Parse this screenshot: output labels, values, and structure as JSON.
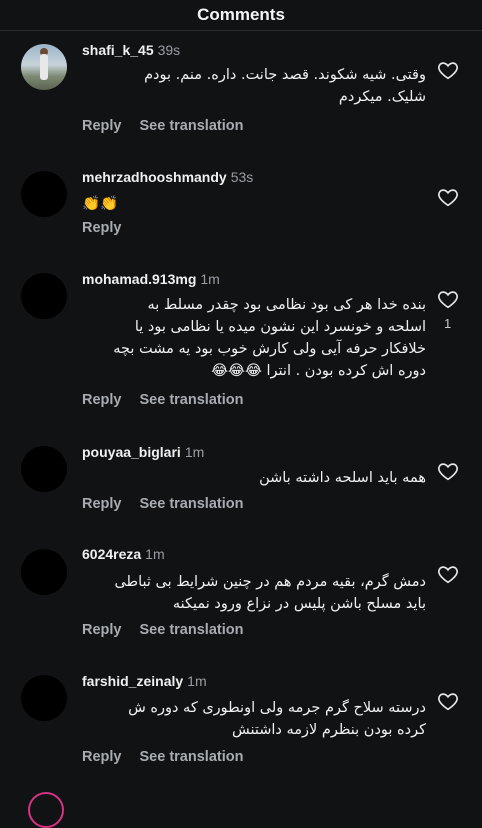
{
  "header": {
    "title": "Comments"
  },
  "labels": {
    "reply": "Reply",
    "see_translation": "See translation"
  },
  "comments": [
    {
      "username": "shafi_k_45",
      "time": "39s",
      "line1": "وقتی.  شیه شکوند. قصد جانت. داره. منم.  بودم",
      "line2": "شلیک. میکردم",
      "likes": ""
    },
    {
      "username": "mehrzadhooshmandy",
      "time": "53s",
      "text": "👏👏",
      "likes": ""
    },
    {
      "username": "mohamad.913mg",
      "time": "1m",
      "line1": "بنده خدا هر کی بود نظامی بود چقدر مسلط به",
      "line2": "اسلحه و خونسرد این نشون میده یا نظامی بود یا",
      "line3": "خلافکار حرفه آیی ولی کارش خوب بود یه مشت بچه",
      "line4": "دوره اش کرده بودن . انترا 😂😂😂",
      "likes": "1"
    },
    {
      "username": "pouyaa_biglari",
      "time": "1m",
      "line1": "همه باید اسلحه داشته باشن",
      "likes": ""
    },
    {
      "username": "6024reza",
      "time": "1m",
      "line1": "دمش گرم، بقیه مردم هم در چنین شرایط بی ثباطی",
      "line2": "باید مسلح باشن پلیس در نزاع ورود نمیکنه",
      "likes": ""
    },
    {
      "username": "farshid_zeinaly",
      "time": "1m",
      "line1": "درسته سلاح گرم جرمه ولی اونطوری که دوره ش",
      "line2": "کرده بودن بنظرم لازمه داشتنش",
      "likes": ""
    }
  ]
}
